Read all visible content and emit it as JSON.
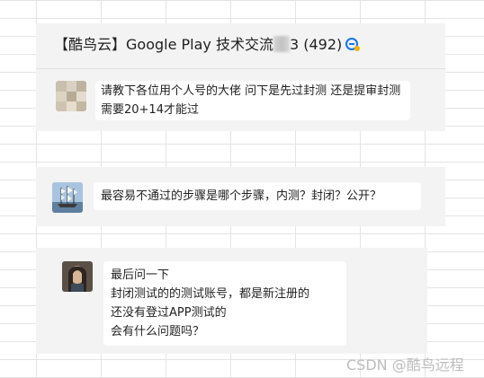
{
  "chat": {
    "title_prefix": "【酷鸟云】Google Play 技术交流",
    "title_suffix": "3 (492)",
    "messages": [
      {
        "text": "请教下各位用个人号的大佬  问下是先过封测  还是提审封测需要20+14才能过"
      },
      {
        "text": "最容易不通过的步骤是哪个步骤，内测？封闭？公开？"
      },
      {
        "lines": [
          "最后问一下",
          "封闭测试的的测试账号，都是新注册的",
          "还没有登过APP测试的",
          "会有什么问题吗？"
        ]
      }
    ]
  },
  "watermark": "CSDN @酷鸟远程",
  "colors": {
    "panel": "#f3f3f3",
    "bubble": "#ffffff",
    "accent": "#1a73e8"
  }
}
